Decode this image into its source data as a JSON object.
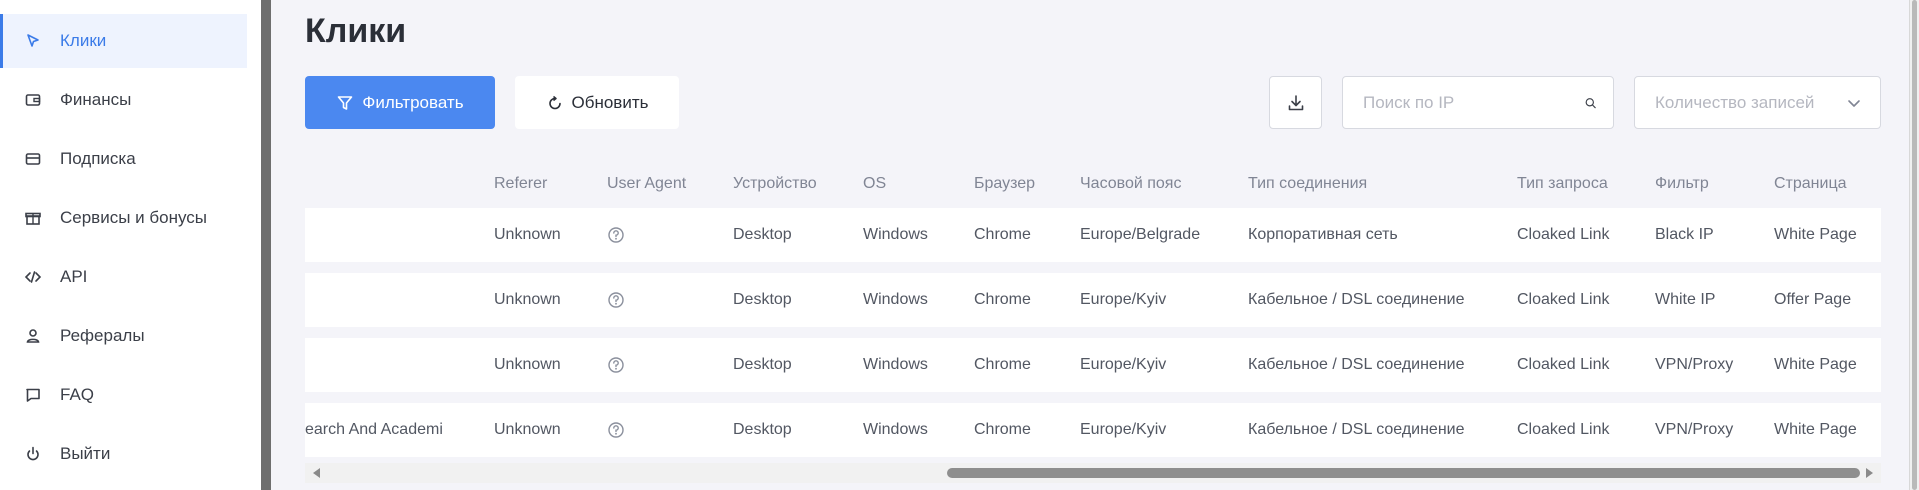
{
  "sidebar": {
    "items": [
      {
        "label": "Клики",
        "icon": "cursor-icon",
        "active": true
      },
      {
        "label": "Финансы",
        "icon": "wallet-icon",
        "active": false
      },
      {
        "label": "Подписка",
        "icon": "card-icon",
        "active": false
      },
      {
        "label": "Сервисы и бонусы",
        "icon": "gift-icon",
        "active": false
      },
      {
        "label": "API",
        "icon": "code-icon",
        "active": false
      },
      {
        "label": "Рефералы",
        "icon": "user-icon",
        "active": false
      },
      {
        "label": "FAQ",
        "icon": "chat-icon",
        "active": false
      },
      {
        "label": "Выйти",
        "icon": "power-icon",
        "active": false
      }
    ]
  },
  "page": {
    "title": "Клики"
  },
  "toolbar": {
    "filter_label": "Фильтровать",
    "refresh_label": "Обновить",
    "download_icon": "download-icon",
    "search_placeholder": "Поиск по IP",
    "records_placeholder": "Количество записей"
  },
  "colors": {
    "accent": "#4b88f0",
    "active_bg": "#eef3fe"
  },
  "table": {
    "columns": [
      "",
      "Referer",
      "User Agent",
      "Устройство",
      "OS",
      "Браузер",
      "Часовой пояс",
      "Тип соединения",
      "Тип запроса",
      "Фильтр",
      "Страница"
    ],
    "rows": [
      [
        "",
        "Unknown",
        "",
        "Desktop",
        "Windows",
        "Chrome",
        "Europe/Belgrade",
        "Корпоративная сеть",
        "Cloaked Link",
        "Black IP",
        "White Page"
      ],
      [
        "",
        "Unknown",
        "",
        "Desktop",
        "Windows",
        "Chrome",
        "Europe/Kyiv",
        "Кабельное / DSL соединение",
        "Cloaked Link",
        "White IP",
        "Offer Page"
      ],
      [
        "",
        "Unknown",
        "",
        "Desktop",
        "Windows",
        "Chrome",
        "Europe/Kyiv",
        "Кабельное / DSL соединение",
        "Cloaked Link",
        "VPN/Proxy",
        "White Page"
      ],
      [
        "earch And Academi",
        "Unknown",
        "",
        "Desktop",
        "Windows",
        "Chrome",
        "Europe/Kyiv",
        "Кабельное / DSL соединение",
        "Cloaked Link",
        "VPN/Proxy",
        "White Page"
      ]
    ]
  }
}
